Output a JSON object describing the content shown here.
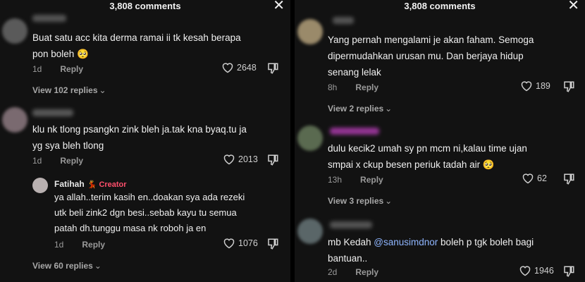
{
  "left": {
    "header": {
      "title": "3,808 comments",
      "close": "✕"
    },
    "comments": [
      {
        "text_lines": [
          "Buat satu acc kita derma ramai ii tk kesah berapa",
          "pon boleh 🥺"
        ],
        "time": "1d",
        "reply": "Reply",
        "likes": "2648",
        "view_replies": "View 102 replies"
      },
      {
        "text_lines": [
          "klu nk tlong psangkn zink bleh ja.tak kna byaq.tu ja",
          "yg sya bleh tlong"
        ],
        "time": "1d",
        "reply": "Reply",
        "likes": "2013"
      }
    ],
    "creator_reply": {
      "name": "Fatihah",
      "badge": "Creator",
      "text_lines": [
        "ya allah..terim kasih en..doakan sya ada rezeki",
        "utk beli zink2 dgn besi..sebab kayu tu semua",
        "patah dh.tunggu masa nk roboh ja en"
      ],
      "time": "1d",
      "reply": "Reply",
      "likes": "1076"
    },
    "view_replies_2": "View 60 replies"
  },
  "right": {
    "header": {
      "title": "3,808 comments",
      "close": "✕"
    },
    "comments": [
      {
        "text_lines": [
          "Yang pernah mengalami je akan faham. Semoga",
          "dipermudahkan urusan mu. Dan berjaya hidup",
          "senang lelak"
        ],
        "time": "8h",
        "reply": "Reply",
        "likes": "189",
        "view_replies": "View 2 replies"
      },
      {
        "text_lines": [
          "dulu kecik2 umah sy pn mcm ni,kalau time ujan",
          "smpai x ckup besen periuk tadah air 🥺"
        ],
        "time": "13h",
        "reply": "Reply",
        "likes": "62",
        "view_replies": "View 3 replies"
      },
      {
        "text_prefix": "mb Kedah ",
        "mention": "@sanusimdnor",
        "text_suffix": " boleh p tgk boleh bagi",
        "text_line2": "bantuan..",
        "time": "2d",
        "reply": "Reply",
        "likes": "1946"
      }
    ]
  },
  "chevron": "⌄",
  "icons": {
    "heart": "heart-icon",
    "dislike": "dislike-icon",
    "close": "close-icon"
  },
  "colors": {
    "background": "#121212",
    "mention": "#8fb6ff",
    "creator": "#ff4f6b",
    "muted": "#9a9a9a"
  }
}
